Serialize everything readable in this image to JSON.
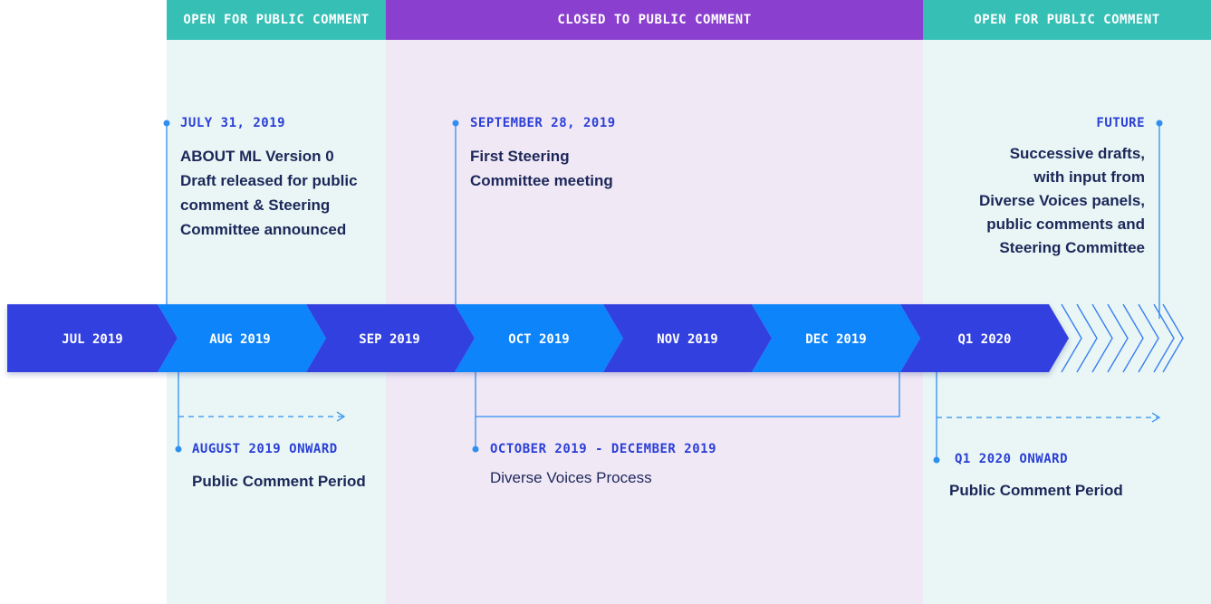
{
  "zones": {
    "open_1": "OPEN FOR PUBLIC COMMENT",
    "closed": "CLOSED TO PUBLIC COMMENT",
    "open_2": "OPEN FOR PUBLIC COMMENT"
  },
  "timeline": {
    "months": [
      "JUL 2019",
      "AUG 2019",
      "SEP 2019",
      "OCT 2019",
      "NOV 2019",
      "DEC 2019",
      "Q1 2020"
    ]
  },
  "events_above": [
    {
      "date": "JULY 31, 2019",
      "lines": [
        "ABOUT ML Version 0",
        "Draft released for public",
        "comment & Steering",
        "Committee announced"
      ]
    },
    {
      "date": "SEPTEMBER 28, 2019",
      "lines": [
        "First Steering",
        "Committee meeting"
      ]
    },
    {
      "date": "FUTURE",
      "lines": [
        "Successive drafts,",
        "with input from",
        "Diverse Voices panels,",
        "public comments and",
        "Steering Committee"
      ]
    }
  ],
  "events_below": [
    {
      "date": "AUGUST 2019 ONWARD",
      "title": "Public Comment Period"
    },
    {
      "date": "OCTOBER 2019 - DECEMBER 2019",
      "title": "Diverse Voices Process"
    },
    {
      "date": "Q1 2020 ONWARD",
      "title": "Public Comment Period"
    }
  ],
  "colors": {
    "dark_blue": "#3340e0",
    "bright_blue": "#0a84fa",
    "accent_text": "#2b3fd6",
    "line_blue": "#2f8ff0",
    "open_bg": "#e9f6f5",
    "closed_bg": "#f1e8f6",
    "open_header": "#36bfb5",
    "closed_header": "#8a3fce"
  }
}
